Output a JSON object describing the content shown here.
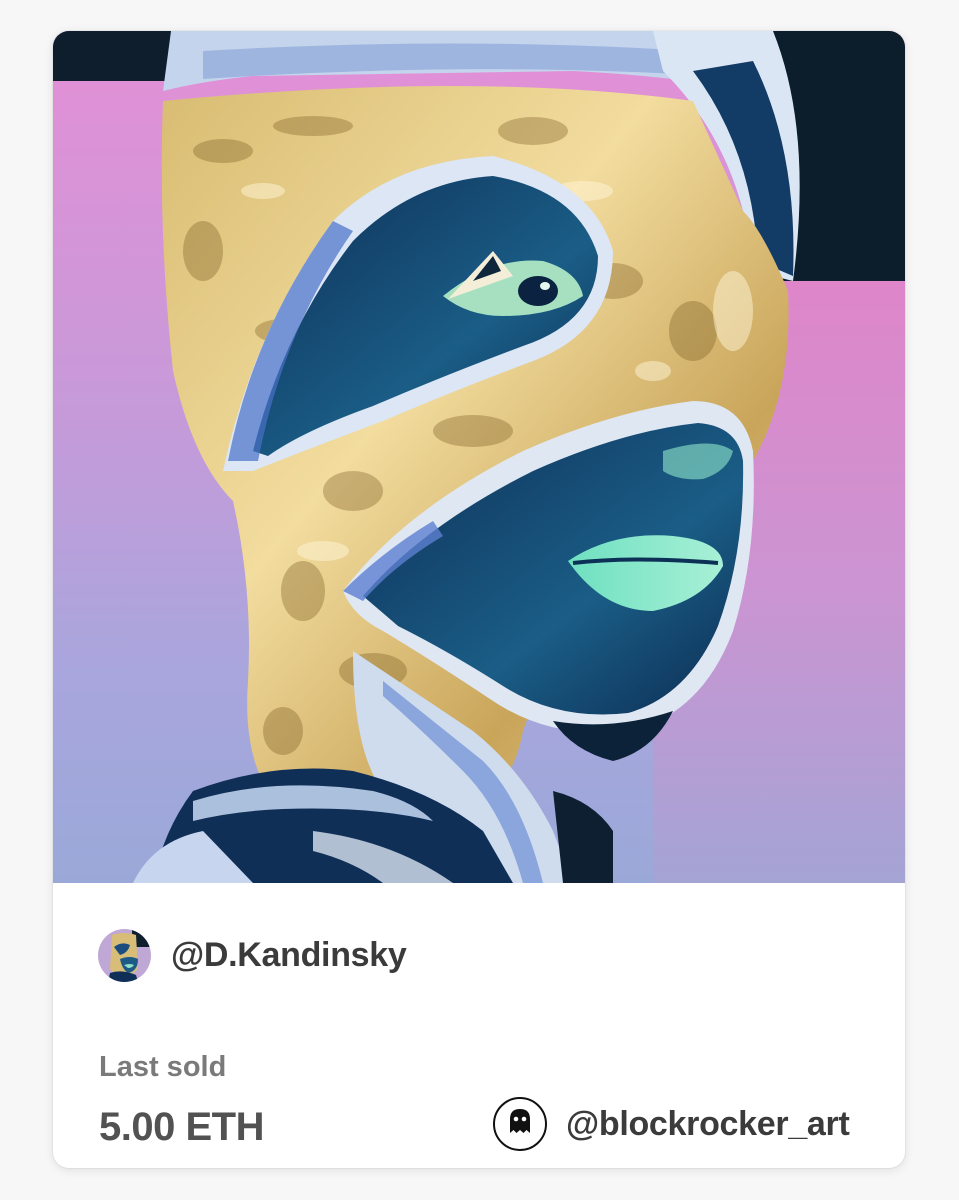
{
  "creator": {
    "handle": "@D.Kandinsky",
    "avatar_icon": "creator-avatar-image"
  },
  "sale": {
    "label": "Last sold",
    "price": "5.00 ETH"
  },
  "owner": {
    "handle": "@blockrocker_art",
    "avatar_icon": "ghost-icon"
  },
  "colors": {
    "text_primary": "#3b3b3b",
    "text_secondary": "#7a7a7a",
    "price": "#525252",
    "card_bg": "#ffffff",
    "page_bg": "#f7f7f8"
  }
}
